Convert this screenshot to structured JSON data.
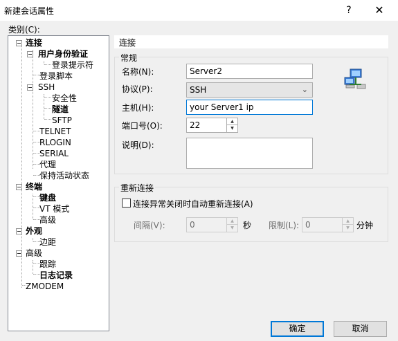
{
  "window": {
    "title": "新建会话属性",
    "help": "?",
    "close": "✕"
  },
  "category_label": "类别(C):",
  "tree": {
    "connection": "连接",
    "auth": "用户身份验证",
    "login_prompt": "登录提示符",
    "login_script": "登录脚本",
    "ssh": "SSH",
    "security": "安全性",
    "tunnel": "隧道",
    "sftp": "SFTP",
    "telnet": "TELNET",
    "rlogin": "RLOGIN",
    "serial": "SERIAL",
    "proxy": "代理",
    "keepalive": "保持活动状态",
    "terminal": "终端",
    "keyboard": "键盘",
    "vt_mode": "VT 模式",
    "term_advanced": "高级",
    "appearance": "外观",
    "margins": "边距",
    "advanced": "高级",
    "trace": "跟踪",
    "logging": "日志记录",
    "zmodem": "ZMODEM"
  },
  "panel": {
    "header": "连接",
    "general": {
      "title": "常规",
      "name_label": "名称(N):",
      "name_value": "Server2",
      "protocol_label": "协议(P):",
      "protocol_value": "SSH",
      "host_label": "主机(H):",
      "host_value": "your Server1 ip",
      "port_label": "端口号(O):",
      "port_value": "22",
      "desc_label": "说明(D):",
      "desc_value": ""
    },
    "reconnect": {
      "title": "重新连接",
      "checkbox_label": "连接异常关闭时自动重新连接(A)",
      "interval_label": "间隔(V):",
      "interval_value": "0",
      "interval_unit": "秒",
      "limit_label": "限制(L):",
      "limit_value": "0",
      "limit_unit": "分钟"
    }
  },
  "buttons": {
    "ok": "确定",
    "cancel": "取消"
  },
  "icons": {
    "network": "network-computers-icon"
  },
  "colors": {
    "accent": "#0078d7"
  }
}
